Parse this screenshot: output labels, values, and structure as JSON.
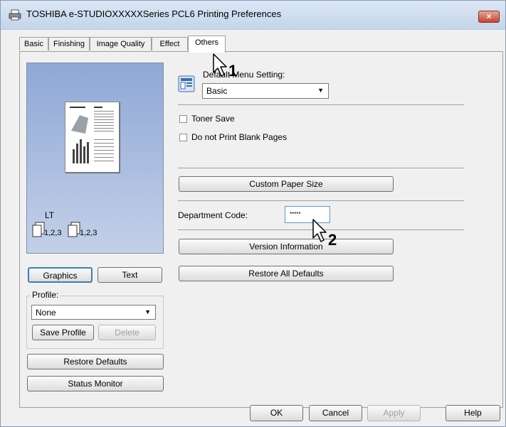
{
  "window": {
    "title": "TOSHIBA e-STUDIOXXXXXSeries PCL6 Printing Preferences",
    "close_label": "×"
  },
  "tabs": [
    {
      "label": "Basic"
    },
    {
      "label": "Finishing"
    },
    {
      "label": "Image Quality"
    },
    {
      "label": "Effect"
    },
    {
      "label": "Others",
      "active": true
    }
  ],
  "preview": {
    "paper_size": "LT",
    "page_order_a": "1,2,3",
    "page_order_b": "1,2,3"
  },
  "left": {
    "graphics_button": "Graphics",
    "text_button": "Text",
    "profile_label": "Profile:",
    "profile_value": "None",
    "save_profile_button": "Save Profile",
    "delete_button": "Delete",
    "restore_defaults_button": "Restore Defaults",
    "status_monitor_button": "Status Monitor"
  },
  "others": {
    "default_menu_label": "Default Menu Setting:",
    "default_menu_value": "Basic",
    "toner_save_label": "Toner Save",
    "toner_save_checked": false,
    "blank_pages_label": "Do not Print Blank Pages",
    "blank_pages_checked": false,
    "custom_paper_button": "Custom Paper Size",
    "department_code_label": "Department Code:",
    "department_code_value": "*****",
    "version_info_button": "Version Information",
    "restore_all_button": "Restore All Defaults"
  },
  "footer": {
    "ok": "OK",
    "cancel": "Cancel",
    "apply": "Apply",
    "help": "Help"
  },
  "annotations": {
    "step1": "1",
    "step2": "2"
  }
}
